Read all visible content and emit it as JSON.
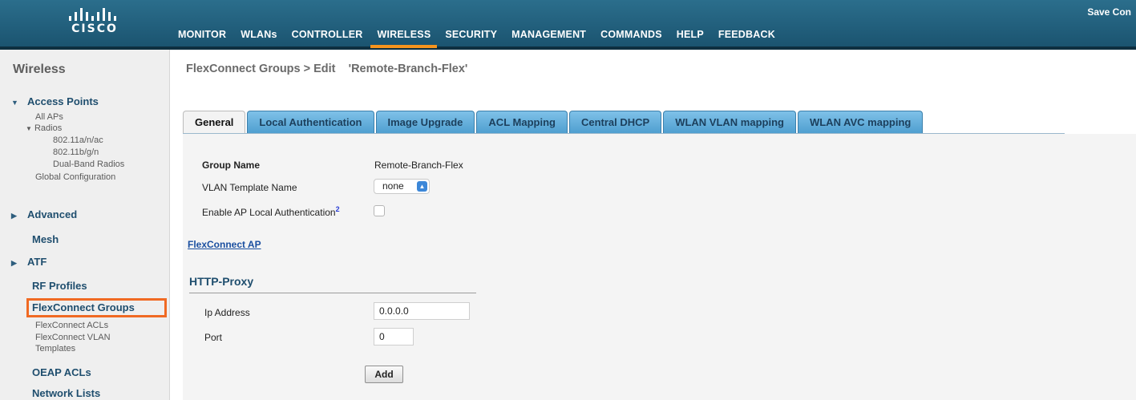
{
  "header": {
    "logo_text": "CISCO",
    "save_text": "Save Con",
    "nav": [
      "MONITOR",
      "WLANs",
      "CONTROLLER",
      "WIRELESS",
      "SECURITY",
      "MANAGEMENT",
      "COMMANDS",
      "HELP",
      "FEEDBACK"
    ],
    "active_nav": "WIRELESS",
    "accent_color": "#f7941d"
  },
  "sidebar": {
    "title": "Wireless",
    "access_points": "Access Points",
    "all_aps": "All APs",
    "radios": "Radios",
    "radio_a": "802.11a/n/ac",
    "radio_b": "802.11b/g/n",
    "dual_band": "Dual-Band Radios",
    "global_config": "Global Configuration",
    "advanced": "Advanced",
    "mesh": "Mesh",
    "atf": "ATF",
    "rf_profiles": "RF Profiles",
    "flexconnect_groups": "FlexConnect Groups",
    "flexconnect_acls": "FlexConnect ACLs",
    "flexconnect_vlan_1": "FlexConnect VLAN",
    "flexconnect_vlan_2": "Templates",
    "oeap_acls": "OEAP ACLs",
    "network_lists": "Network Lists",
    "highlight_color": "#f06a23"
  },
  "main": {
    "breadcrumb": "FlexConnect Groups > Edit",
    "group_title": "'Remote-Branch-Flex'",
    "tabs": [
      "General",
      "Local Authentication",
      "Image Upgrade",
      "ACL Mapping",
      "Central DHCP",
      "WLAN VLAN mapping",
      "WLAN AVC mapping"
    ],
    "active_tab": "General",
    "group_name_label": "Group Name",
    "group_name_value": "Remote-Branch-Flex",
    "vlan_template_label": "VLAN Template Name",
    "vlan_template_value": "none",
    "local_auth_label": "Enable AP Local Authentication",
    "local_auth_footnote": "2",
    "flexconnect_ap_link": "FlexConnect AP",
    "http_proxy_heading": "HTTP-Proxy",
    "ip_label": "Ip Address",
    "ip_value": "0.0.0.0",
    "port_label": "Port",
    "port_value": "0",
    "add_button": "Add"
  }
}
